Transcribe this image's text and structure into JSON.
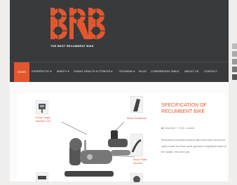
{
  "site": {
    "tagline": "THE BEST RECUMBENT BIKE",
    "logo_text": "BRB",
    "accent_color": "#e4572e",
    "header_color": "#383a3b"
  },
  "nav": {
    "items": [
      {
        "label": "HOME"
      },
      {
        "label": "EXERPEUTIC ▾"
      },
      {
        "label": "MARCY ▾"
      },
      {
        "label": "SUNNY HEALTH & FITNESS ▾"
      },
      {
        "label": "SCHWINN ▾"
      },
      {
        "label": "BLOG"
      },
      {
        "label": "COMPARISON TABLE"
      },
      {
        "label": "ABOUT US"
      },
      {
        "label": "CONTACT"
      }
    ]
  },
  "product_image": {
    "callouts": [
      {
        "text": "Extra Large\nBacklit LCD"
      },
      {
        "text": "Mesh Seatback"
      },
      {
        "text": "Heart Rate\nMonitor"
      }
    ]
  },
  "post": {
    "title": "SPECIFICATION OF RECUMBENT BIKE",
    "date": "December 7, 2016",
    "author": "admin",
    "excerpt": "Recumbent (meaning reclined) bikes have been around for quite a while, but have never garnered a significant share of the market. This isn't hard."
  },
  "social": {
    "icons": [
      "facebook-icon",
      "twitter-icon",
      "pinterest-icon",
      "rss-icon",
      "tumblr-icon"
    ]
  }
}
